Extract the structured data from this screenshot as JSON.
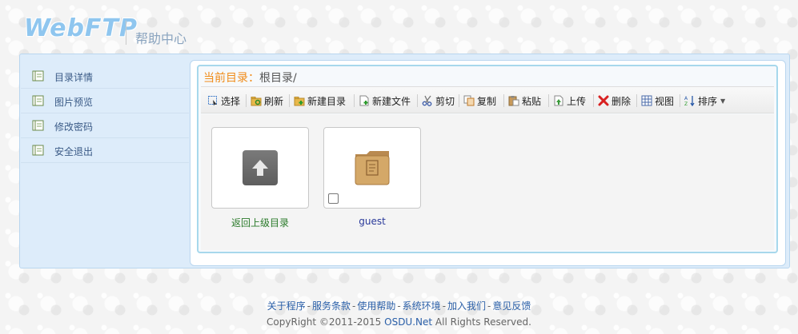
{
  "header": {
    "logo": "WebFTP",
    "title": "帮助中心"
  },
  "sidebar": {
    "items": [
      {
        "label": "目录详情"
      },
      {
        "label": "图片预览"
      },
      {
        "label": "修改密码"
      },
      {
        "label": "安全退出"
      }
    ]
  },
  "location": {
    "label": "当前目录：",
    "path": "根目录/"
  },
  "toolbar": {
    "select": "选择",
    "refresh": "刷新",
    "new_dir": "新建目录",
    "new_file": "新建文件",
    "cut": "剪切",
    "copy": "复制",
    "paste": "粘贴",
    "upload": "上传",
    "delete": "删除",
    "view": "视图",
    "sort": "排序"
  },
  "files": [
    {
      "name": "返回上级目录",
      "type": "parent"
    },
    {
      "name": "guest",
      "type": "folder"
    }
  ],
  "footer": {
    "links": [
      "关于程序",
      "服务条款",
      "使用帮助",
      "系统环境",
      "加入我们",
      "意见反馈"
    ],
    "copyright_prefix": "CopyRight ©2011-2015 ",
    "copyright_link": "OSDU.Net",
    "copyright_suffix": " All Rights Reserved."
  },
  "colors": {
    "accent": "#f08c1a",
    "link": "#2a5fa8",
    "sidebar_bg": "#ddecfa"
  }
}
